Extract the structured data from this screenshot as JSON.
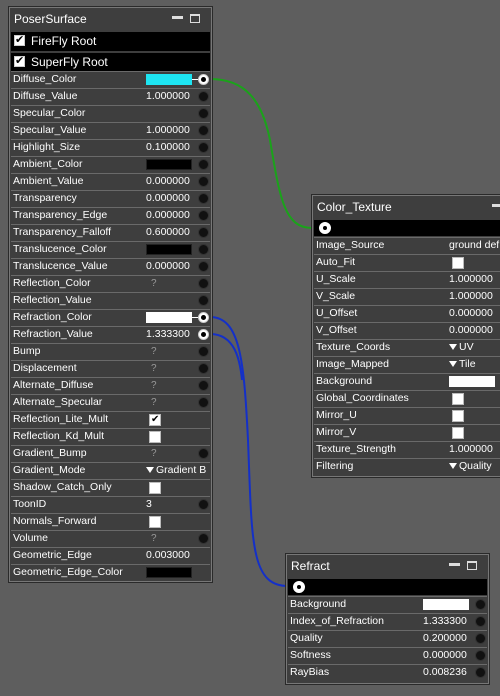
{
  "colors": {
    "diffuse_swatch": "#1ee5f2",
    "green_wire": "#1aa31a",
    "blue_wire": "#1430c8",
    "node_bg": "#3e3e3e",
    "canvas_bg": "#5e5e5e"
  },
  "poser": {
    "title": "PoserSurface",
    "firefly_root": "FireFly Root",
    "superfly_root": "SuperFly Root",
    "rows": {
      "diffuse_color": "Diffuse_Color",
      "diffuse_value": {
        "label": "Diffuse_Value",
        "value": "1.000000"
      },
      "specular_color": "Specular_Color",
      "specular_value": {
        "label": "Specular_Value",
        "value": "1.000000"
      },
      "highlight_size": {
        "label": "Highlight_Size",
        "value": "0.100000"
      },
      "ambient_color": "Ambient_Color",
      "ambient_value": {
        "label": "Ambient_Value",
        "value": "0.000000"
      },
      "transparency": {
        "label": "Transparency",
        "value": "0.000000"
      },
      "transparency_edge": {
        "label": "Transparency_Edge",
        "value": "0.000000"
      },
      "transparency_falloff": {
        "label": "Transparency_Falloff",
        "value": "0.600000"
      },
      "translucence_color": "Translucence_Color",
      "translucence_value": {
        "label": "Translucence_Value",
        "value": "0.000000"
      },
      "reflection_color": {
        "label": "Reflection_Color",
        "q": "?"
      },
      "reflection_value": "Reflection_Value",
      "refraction_color": "Refraction_Color",
      "refraction_value": {
        "label": "Refraction_Value",
        "value": "1.333300"
      },
      "bump": {
        "label": "Bump",
        "q": "?"
      },
      "displacement": {
        "label": "Displacement",
        "q": "?"
      },
      "alternate_diffuse": {
        "label": "Alternate_Diffuse",
        "q": "?"
      },
      "alternate_specular": {
        "label": "Alternate_Specular",
        "q": "?"
      },
      "reflection_lite_mult": "Reflection_Lite_Mult",
      "reflection_kd_mult": "Reflection_Kd_Mult",
      "gradient_bump": {
        "label": "Gradient_Bump",
        "q": "?"
      },
      "gradient_mode": {
        "label": "Gradient_Mode",
        "value": "Gradient B"
      },
      "shadow_catch_only": "Shadow_Catch_Only",
      "toonid": {
        "label": "ToonID",
        "value": "3"
      },
      "normals_forward": "Normals_Forward",
      "volume": {
        "label": "Volume",
        "q": "?"
      },
      "geometric_edge": {
        "label": "Geometric_Edge",
        "value": "0.003000"
      },
      "geometric_edge_color": "Geometric_Edge_Color"
    }
  },
  "color_texture": {
    "title": "Color_Texture",
    "rows": {
      "image_source": {
        "label": "Image_Source",
        "value": "ground def"
      },
      "auto_fit": "Auto_Fit",
      "u_scale": {
        "label": "U_Scale",
        "value": "1.000000"
      },
      "v_scale": {
        "label": "V_Scale",
        "value": "1.000000"
      },
      "u_offset": {
        "label": "U_Offset",
        "value": "0.000000"
      },
      "v_offset": {
        "label": "V_Offset",
        "value": "0.000000"
      },
      "texture_coords": {
        "label": "Texture_Coords",
        "value": "UV"
      },
      "image_mapped": {
        "label": "Image_Mapped",
        "value": "Tile"
      },
      "background": "Background",
      "global_coordinates": "Global_Coordinates",
      "mirror_u": "Mirror_U",
      "mirror_v": "Mirror_V",
      "texture_strength": {
        "label": "Texture_Strength",
        "value": "1.000000"
      },
      "filtering": {
        "label": "Filtering",
        "value": "Quality"
      }
    }
  },
  "refract": {
    "title": "Refract",
    "rows": {
      "background": "Background",
      "index_of_refraction": {
        "label": "Index_of_Refraction",
        "value": "1.333300"
      },
      "quality": {
        "label": "Quality",
        "value": "0.200000"
      },
      "softness": {
        "label": "Softness",
        "value": "0.000000"
      },
      "raybias": {
        "label": "RayBias",
        "value": "0.008236"
      }
    }
  }
}
